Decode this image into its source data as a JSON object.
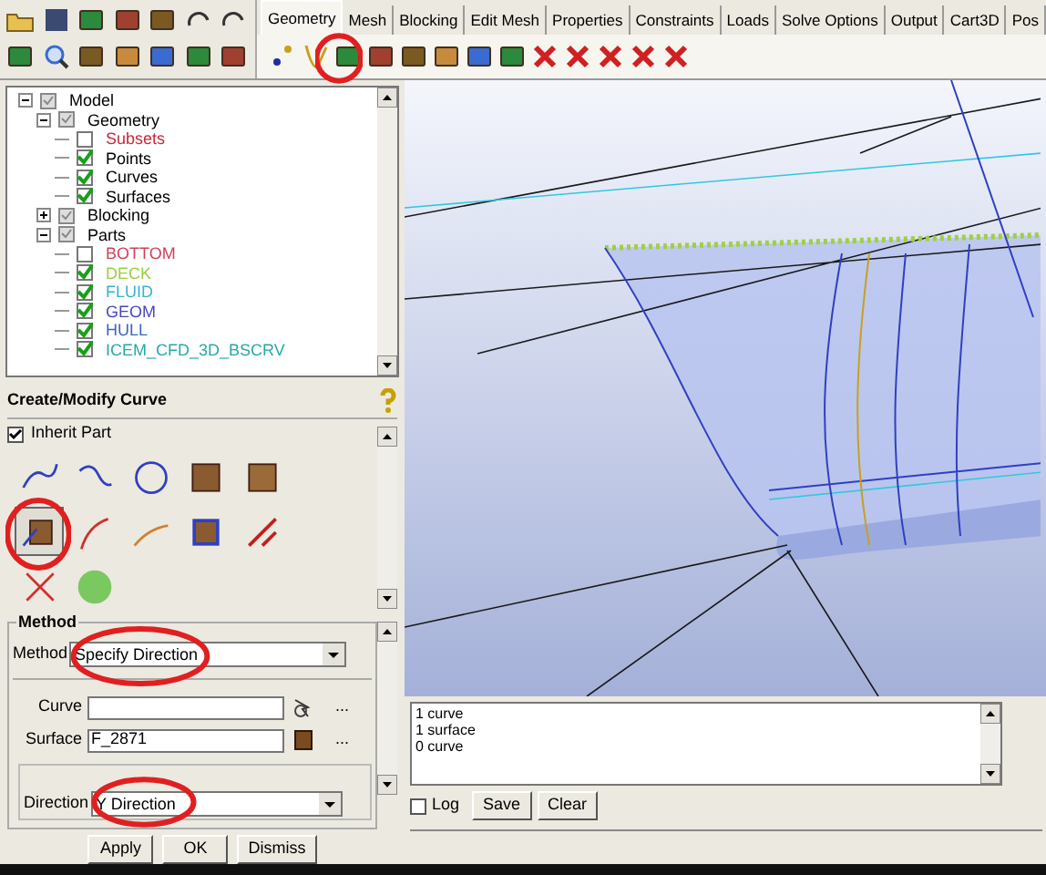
{
  "tabs": [
    {
      "label": "Geometry",
      "selected": true
    },
    {
      "label": "Mesh",
      "selected": false
    },
    {
      "label": "Blocking",
      "selected": false
    },
    {
      "label": "Edit Mesh",
      "selected": false
    },
    {
      "label": "Properties",
      "selected": false
    },
    {
      "label": "Constraints",
      "selected": false
    },
    {
      "label": "Loads",
      "selected": false
    },
    {
      "label": "Solve Options",
      "selected": false
    },
    {
      "label": "Output",
      "selected": false
    },
    {
      "label": "Cart3D",
      "selected": false
    },
    {
      "label": "Pos",
      "selected": false
    }
  ],
  "tree": [
    {
      "label": "Model",
      "kind": "group",
      "expanded": true,
      "children": [
        {
          "label": "Geometry",
          "kind": "group",
          "expanded": true,
          "children": [
            {
              "label": "Subsets",
              "kind": "leaf",
              "checked": false,
              "color": "#c8283c"
            },
            {
              "label": "Points",
              "kind": "leaf",
              "checked": true,
              "color": "#000000"
            },
            {
              "label": "Curves",
              "kind": "leaf",
              "checked": true,
              "color": "#000000"
            },
            {
              "label": "Surfaces",
              "kind": "leaf",
              "checked": true,
              "color": "#000000"
            }
          ]
        },
        {
          "label": "Blocking",
          "kind": "group",
          "expanded": false
        },
        {
          "label": "Parts",
          "kind": "group",
          "expanded": true,
          "children": [
            {
              "label": "BOTTOM",
              "kind": "leaf",
              "checked": false,
              "color": "#d04058"
            },
            {
              "label": "DECK",
              "kind": "leaf",
              "checked": true,
              "color": "#9ccc3c"
            },
            {
              "label": "FLUID",
              "kind": "leaf",
              "checked": true,
              "color": "#38b0d0"
            },
            {
              "label": "GEOM",
              "kind": "leaf",
              "checked": true,
              "color": "#4848b8"
            },
            {
              "label": "HULL",
              "kind": "leaf",
              "checked": true,
              "color": "#3c64c0"
            },
            {
              "label": "ICEM_CFD_3D_BSCRV",
              "kind": "leaf",
              "checked": true,
              "color": "#28a8a8"
            }
          ]
        }
      ]
    }
  ],
  "panel": {
    "title": "Create/Modify Curve",
    "inherit_part": {
      "label": "Inherit Part",
      "checked": true
    },
    "tools": [
      {
        "selected": false
      },
      {
        "selected": false
      },
      {
        "selected": false
      },
      {
        "selected": false
      },
      {
        "selected": false
      },
      {
        "selected": true
      },
      {
        "selected": false
      },
      {
        "selected": false
      },
      {
        "selected": false
      },
      {
        "selected": false
      },
      {
        "selected": false
      },
      {
        "selected": false
      }
    ],
    "method_group": "Method",
    "method_label": "Method",
    "method_value": "Specify Direction",
    "curve_label": "Curve",
    "surface_label": "Surface",
    "surface_value": "F_2871",
    "more": "...",
    "direction_label": "Direction",
    "direction_value": "Y Direction",
    "buttons": [
      "Apply",
      "OK",
      "Dismiss"
    ]
  },
  "messages": {
    "lines": [
      "1 curve",
      "1 surface",
      "0 curve"
    ],
    "log": {
      "label": "Log",
      "checked": false
    },
    "buttons": [
      "Save",
      "Clear"
    ]
  }
}
